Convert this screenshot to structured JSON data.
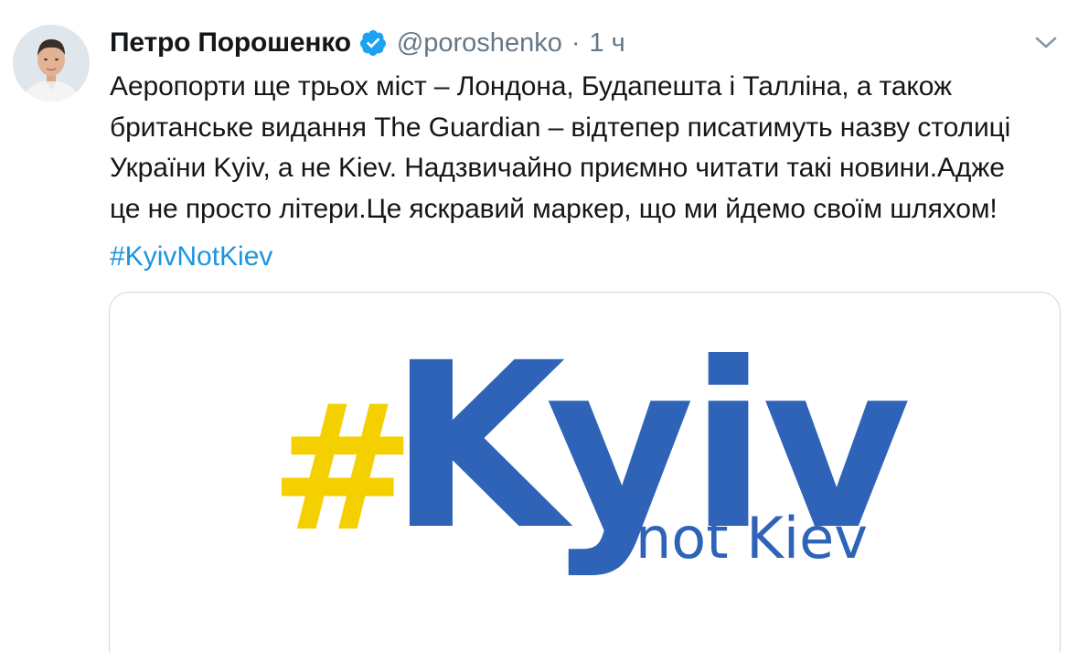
{
  "tweet": {
    "author_name": "Петро Порошенко",
    "handle": "@poroshenko",
    "separator": "·",
    "timestamp": "1 ч",
    "verified": true,
    "body_lines": [
      "Аеропорти ще трьох міст – Лондона, Будапешта і Талліна, а також",
      "британське видання The Guardian – відтепер писатимуть назву столиці",
      "України Kyiv, а не Kiev. Надзвичайно приємно читати такі новини.Адже",
      "це не просто літери.Це яскравий маркер, що ми йдемо своїм шляхом!"
    ],
    "hashtag": "#KyivNotKiev",
    "link_color": "#1b95e0",
    "text_color": "#14171a",
    "meta_color": "#657786"
  },
  "media": {
    "hash_symbol": "#",
    "main_word": "Kyiv",
    "subtitle": "not Kiev",
    "hash_color": "#f5d000",
    "word_color": "#2e63b8",
    "subtitle_color": "#2e63b8"
  },
  "icons": {
    "verified": "verified-badge-icon",
    "menu": "chevron-down-icon"
  }
}
